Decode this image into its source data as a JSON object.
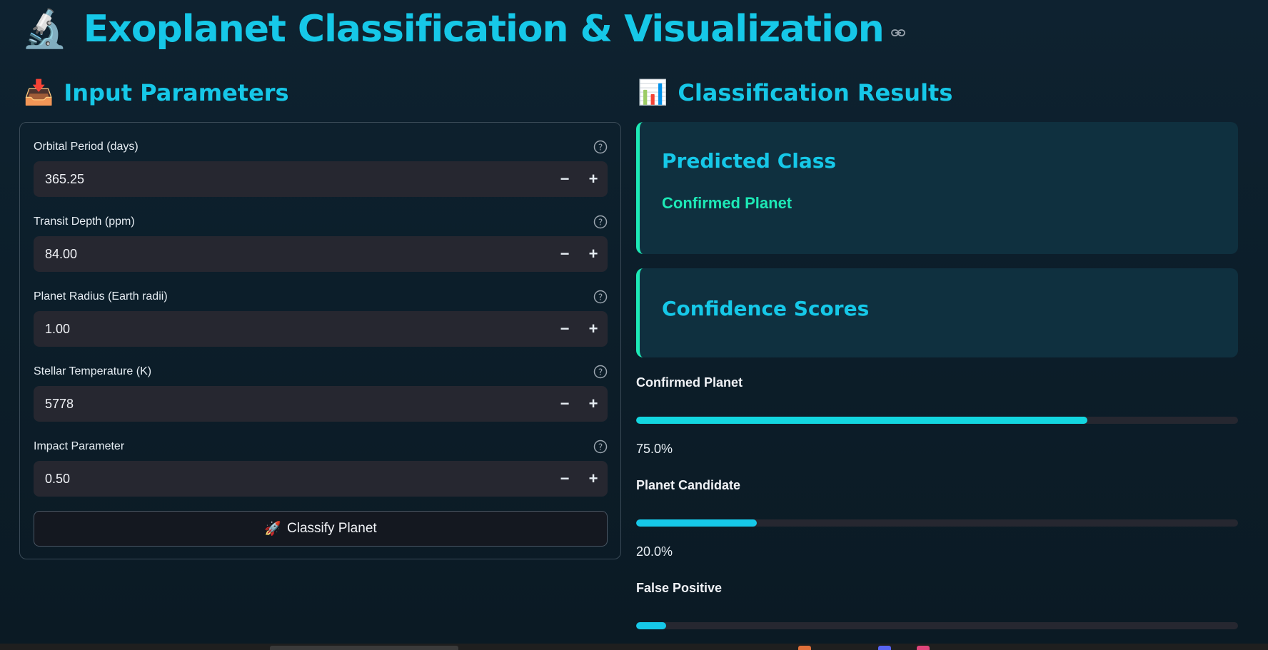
{
  "header": {
    "emoji": "🔬",
    "title": "Exoplanet Classification & Visualization"
  },
  "input_section": {
    "emoji": "📥",
    "heading": "Input Parameters",
    "fields": [
      {
        "label": "Orbital Period (days)",
        "value": "365.25"
      },
      {
        "label": "Transit Depth (ppm)",
        "value": "84.00"
      },
      {
        "label": "Planet Radius (Earth radii)",
        "value": "1.00"
      },
      {
        "label": "Stellar Temperature (K)",
        "value": "5778"
      },
      {
        "label": "Impact Parameter",
        "value": "0.50"
      }
    ],
    "decrement_symbol": "−",
    "increment_symbol": "+",
    "classify_button": {
      "emoji": "🚀",
      "label": "Classify Planet"
    }
  },
  "results_section": {
    "emoji": "📊",
    "heading": "Classification Results",
    "predicted_card": {
      "title": "Predicted Class",
      "value": "Confirmed Planet"
    },
    "confidence_card": {
      "title": "Confidence Scores"
    },
    "scores": [
      {
        "label": "Confirmed Planet",
        "fraction": 0.75,
        "text": "75.0%",
        "color": "#13d6e0"
      },
      {
        "label": "Planet Candidate",
        "fraction": 0.2,
        "text": "20.0%",
        "color": "#16c8e8"
      },
      {
        "label": "False Positive",
        "fraction": 0.05,
        "text": "",
        "color": "#16c8e8"
      }
    ]
  },
  "colors": {
    "accent": "#16c8e8",
    "success": "#1de9b6",
    "input_bg": "#262730",
    "card_bg": "#0f303f"
  },
  "icons": {
    "link": "link-icon",
    "help": "help-circle-icon"
  }
}
